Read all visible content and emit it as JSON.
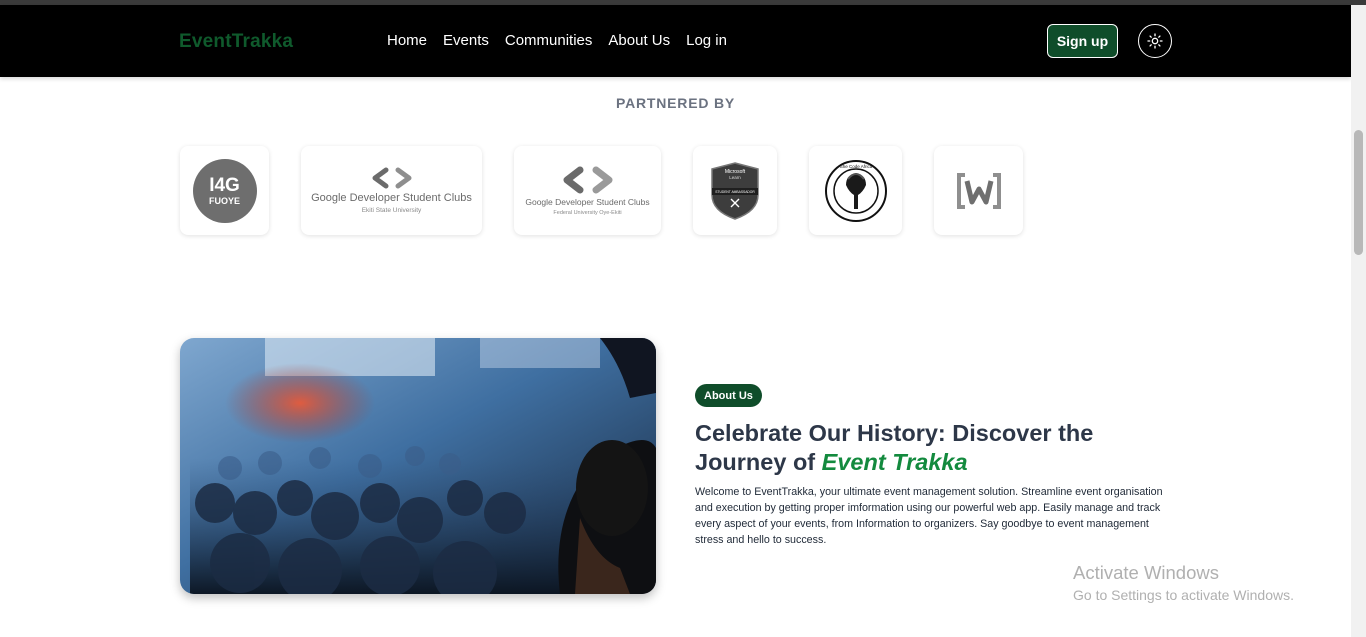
{
  "nav": {
    "logo": "EventTrakka",
    "links": [
      "Home",
      "Events",
      "Communities",
      "About Us",
      "Log in"
    ],
    "signup": "Sign up",
    "theme_icon": "sun-icon"
  },
  "partners": {
    "heading": "PARTNERED BY",
    "items": [
      {
        "name": "i4g",
        "line1": "I4G",
        "line2": "FUOYE"
      },
      {
        "name": "gdsc-eksu",
        "title": "Google Developer Student Clubs",
        "sub": "Ekiti State University"
      },
      {
        "name": "gdsc-fuoye",
        "title": "Google Developer Student Clubs",
        "sub": "Federal University Oye-Ekiti"
      },
      {
        "name": "microsoft-learn",
        "line1": "Microsoft",
        "line2": "Learn",
        "line3": "STUDENT AMBASSADOR"
      },
      {
        "name": "she-code-africa",
        "text": "She Code Africa"
      },
      {
        "name": "w-logo",
        "text": "[W]"
      }
    ]
  },
  "about": {
    "badge": "About Us",
    "heading_part1": "Celebrate Our History: Discover the Journey of ",
    "heading_accent": "Event Trakka",
    "description": "Welcome to EventTrakka, your ultimate event management solution. Streamline event organisation and execution by getting proper imformation using our powerful web app. Easily manage and track every aspect of your events, from Information to organizers. Say goodbye to event management stress and hello to success."
  },
  "watermark": {
    "title": "Activate Windows",
    "subtitle": "Go to Settings to activate Windows."
  },
  "colors": {
    "brand_green": "#0f4d2a",
    "accent_green": "#138a3e",
    "nav_bg": "#000000"
  }
}
